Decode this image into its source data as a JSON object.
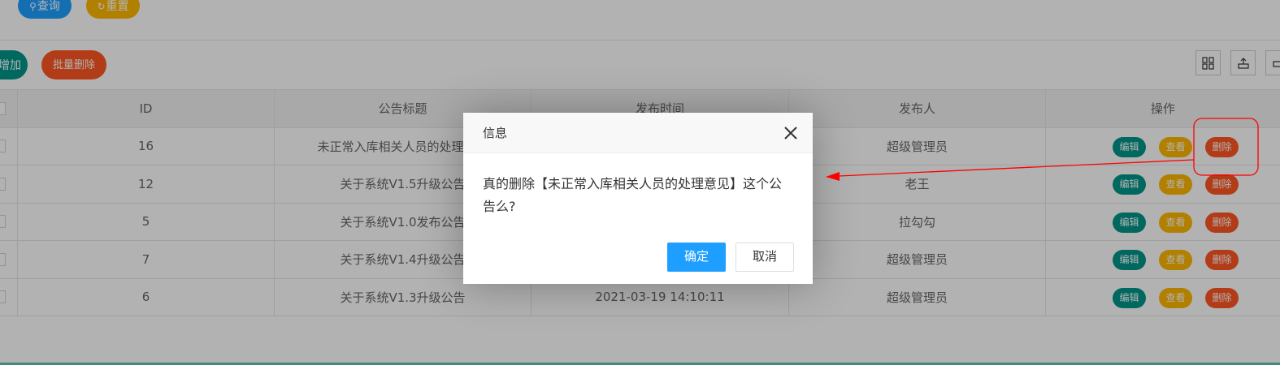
{
  "search": {
    "query_label": "查询",
    "reset_label": "重置"
  },
  "toolbar": {
    "add_label": "增加",
    "batch_delete_label": "批量删除"
  },
  "table": {
    "headers": {
      "id": "ID",
      "title": "公告标题",
      "time": "发布时间",
      "publisher": "发布人",
      "ops": "操作"
    },
    "rows": [
      {
        "id": "16",
        "title": "未正常入库相关人员的处理意见",
        "time": "",
        "publisher": "超级管理员"
      },
      {
        "id": "12",
        "title": "关于系统V1.5升级公告",
        "time": "",
        "publisher": "老王"
      },
      {
        "id": "5",
        "title": "关于系统V1.0发布公告",
        "time": "",
        "publisher": "拉勾勾"
      },
      {
        "id": "7",
        "title": "关于系统V1.4升级公告",
        "time": "",
        "publisher": "超级管理员"
      },
      {
        "id": "6",
        "title": "关于系统V1.3升级公告",
        "time": "2021-03-19 14:10:11",
        "publisher": "超级管理员"
      }
    ],
    "ops": {
      "edit": "编辑",
      "view": "查看",
      "delete": "删除"
    }
  },
  "dialog": {
    "title": "信息",
    "message": "真的删除【未正常入库相关人员的处理意见】这个公告么?",
    "ok_label": "确定",
    "cancel_label": "取消"
  },
  "colors": {
    "primary": "#1e9fff",
    "warm": "#ffb800",
    "danger": "#ff5722",
    "teal": "#009688",
    "annotation": "#ff0000"
  }
}
